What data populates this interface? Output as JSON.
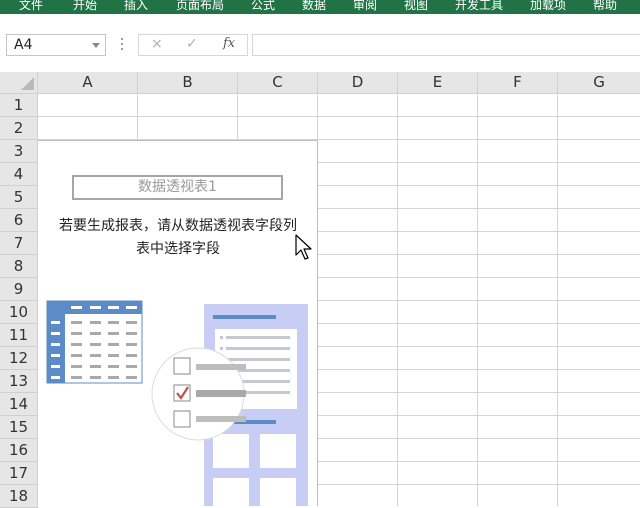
{
  "ribbon": {
    "color": "#217346",
    "tabs": [
      "文件",
      "开始",
      "插入",
      "页面布局",
      "公式",
      "数据",
      "审阅",
      "视图",
      "开发工具",
      "加载项",
      "帮助"
    ]
  },
  "formula_bar": {
    "name_box": "A4",
    "cancel_icon": "×",
    "enter_icon": "✓",
    "fx_label": "fx",
    "formula": ""
  },
  "columns": [
    "A",
    "B",
    "C",
    "D",
    "E",
    "F",
    "G"
  ],
  "rows": [
    "1",
    "2",
    "3",
    "4",
    "5",
    "6",
    "7",
    "8",
    "9",
    "10",
    "11",
    "12",
    "13",
    "14",
    "15",
    "16",
    "17",
    "18"
  ],
  "pivot": {
    "title": "数据透视表1",
    "message_line1": "若要生成报表，请从数据透视表字段列",
    "message_line2": "表中选择字段",
    "accent_blue": "#5b8cc8",
    "panel_lavender": "#c8cdf6",
    "check_color": "#c0504d"
  }
}
